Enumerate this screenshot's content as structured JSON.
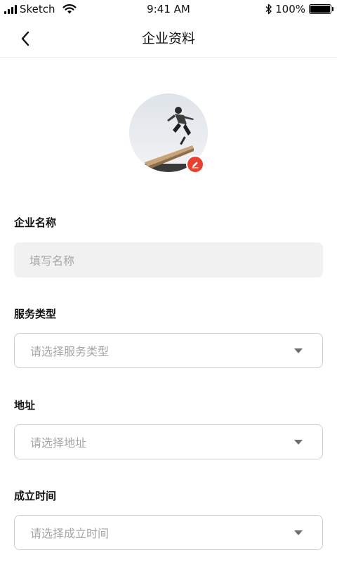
{
  "status_bar": {
    "carrier": "Sketch",
    "time": "9:41 AM",
    "battery": "100%",
    "battery_level": 1.0
  },
  "nav": {
    "title": "企业资料",
    "back_icon": "chevron-left-icon"
  },
  "avatar": {
    "edit_icon": "pencil-icon",
    "edit_badge_color": "#e8412f"
  },
  "form": {
    "company_name": {
      "label": "企业名称",
      "placeholder": "填写名称",
      "value": ""
    },
    "service_type": {
      "label": "服务类型",
      "placeholder": "请选择服务类型",
      "value": ""
    },
    "address": {
      "label": "地址",
      "placeholder": "请选择地址",
      "value": ""
    },
    "founded": {
      "label": "成立时间",
      "placeholder": "请选择成立时间",
      "value": ""
    }
  },
  "colors": {
    "accent": "#e8412f",
    "placeholder": "#a6a6a6",
    "input_fill": "#f1f1f1",
    "input_border": "#cfcfcf"
  }
}
